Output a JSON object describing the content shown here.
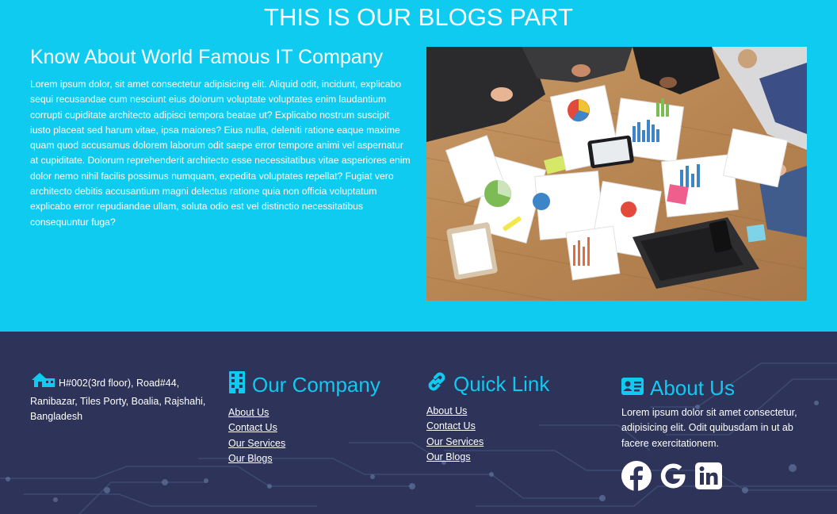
{
  "blogs": {
    "heading": "THIS IS OUR BLOGS PART",
    "title": "Know About World Famous IT Company",
    "body": "Lorem ipsum dolor, sit amet consectetur adipisicing elit. Aliquid odit, incidunt, explicabo sequi recusandae cum nesciunt eius dolorum voluptate voluptates enim laudantium corrupti cupiditate architecto adipisci tempora beatae ut? Explicabo nostrum suscipit iusto placeat sed harum vitae, ipsa maiores? Eius nulla, deleniti ratione eaque maxime quam quod accusamus dolorem laborum odit saepe error tempore animi vel aspernatur at cupiditate. Dolorum reprehenderit architecto esse necessitatibus vitae asperiores enim dolor nemo nihil facilis possimus numquam, expedita voluptates repellat? Fugiat vero architecto debitis accusantium magni delectus ratione quia non officia voluptatum explicabo error repudiandae ullam, soluta odio est vel distinctio necessitatibus consequuntur fuga?"
  },
  "footer": {
    "address": "H#002(3rd floor), Road#44, Ranibazar, Tiles Porty, Boalia, Rajshahi, Bangladesh",
    "company": {
      "heading": "Our Company",
      "links": [
        "About Us",
        "Contact Us",
        "Our Services",
        "Our Blogs"
      ]
    },
    "quick": {
      "heading": "Quick Link",
      "links": [
        "About Us",
        "Contact Us",
        "Our Services",
        "Our Blogs"
      ]
    },
    "about": {
      "heading": "About Us",
      "text": "Lorem ipsum dolor sit amet consectetur, adipisicing elit. Odit quibusdam in ut ab facere exercitationem."
    },
    "social_icons": [
      "facebook-icon",
      "google-icon",
      "linkedin-icon"
    ]
  },
  "colors": {
    "accent": "#10cbef",
    "footer_bg": "#2d3359"
  }
}
